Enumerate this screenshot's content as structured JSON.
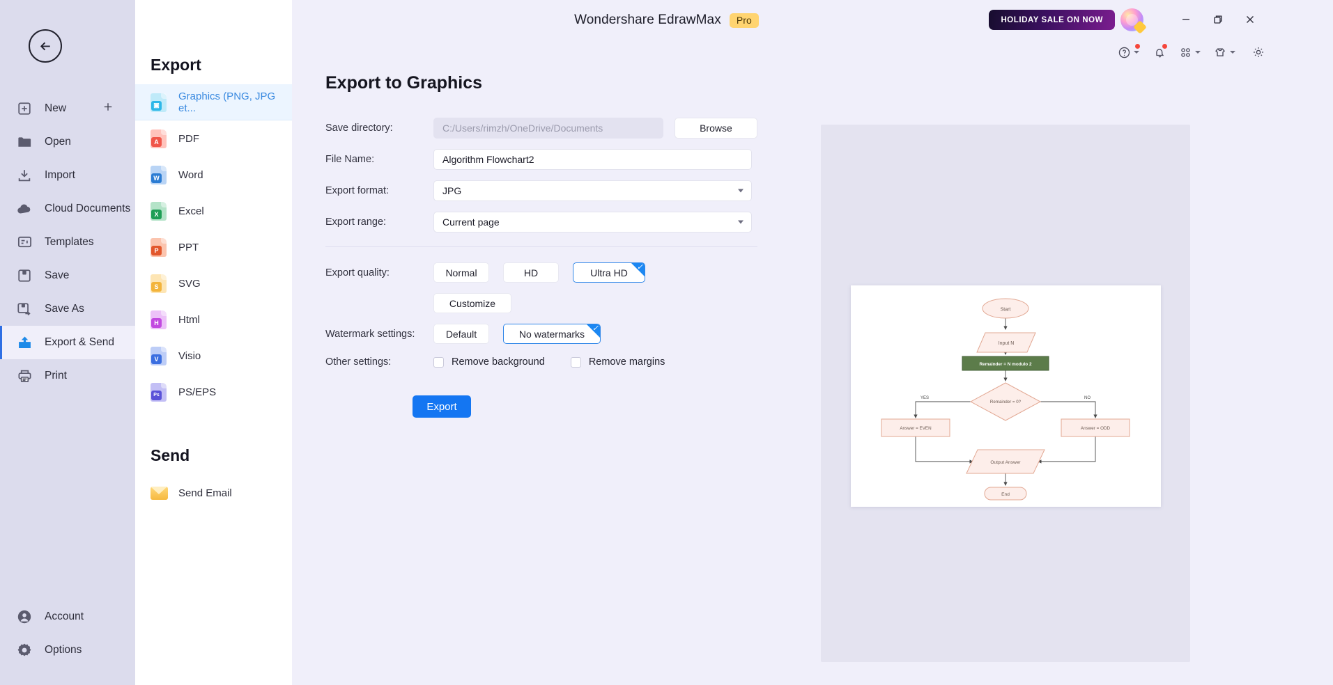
{
  "window": {
    "app_title": "Wondershare EdrawMax",
    "pro_badge": "Pro",
    "holiday_button": "HOLIDAY SALE ON NOW",
    "minimize_icon": "minimize-icon",
    "maximize_icon": "restore-icon",
    "close_icon": "close-icon",
    "avatar_icon": "user-avatar"
  },
  "toolbar": {
    "help_icon": "help-circle-icon",
    "notification_icon": "bell-icon",
    "apps_icon": "grid-apps-icon",
    "theme_icon": "shirt-theme-icon",
    "settings_icon": "gear-icon"
  },
  "rail": {
    "back_icon": "back-arrow-icon",
    "items": [
      {
        "label": "New",
        "icon": "new-document-icon",
        "active": false,
        "trailing": "plus-icon"
      },
      {
        "label": "Open",
        "icon": "folder-icon",
        "active": false
      },
      {
        "label": "Import",
        "icon": "import-icon",
        "active": false
      },
      {
        "label": "Cloud Documents",
        "icon": "cloud-icon",
        "active": false
      },
      {
        "label": "Templates",
        "icon": "templates-icon",
        "active": false
      },
      {
        "label": "Save",
        "icon": "save-disk-icon",
        "active": false
      },
      {
        "label": "Save As",
        "icon": "save-as-icon",
        "active": false
      },
      {
        "label": "Export & Send",
        "icon": "export-send-icon",
        "active": true
      },
      {
        "label": "Print",
        "icon": "printer-icon",
        "active": false
      }
    ],
    "bottom_items": [
      {
        "label": "Account",
        "icon": "account-icon"
      },
      {
        "label": "Options",
        "icon": "options-gear-icon"
      }
    ]
  },
  "export_panel": {
    "heading": "Export",
    "formats": [
      {
        "label": "Graphics (PNG, JPG et...",
        "icon": "image-file-icon",
        "color": "#45c4f0",
        "tag": "",
        "active": true
      },
      {
        "label": "PDF",
        "icon": "pdf-file-icon",
        "color": "#f0564a",
        "tag": "A",
        "active": false
      },
      {
        "label": "Word",
        "icon": "word-file-icon",
        "color": "#2b7cd3",
        "tag": "W",
        "active": false
      },
      {
        "label": "Excel",
        "icon": "excel-file-icon",
        "color": "#1e9e55",
        "tag": "X",
        "active": false
      },
      {
        "label": "PPT",
        "icon": "ppt-file-icon",
        "color": "#e2572c",
        "tag": "P",
        "active": false
      },
      {
        "label": "SVG",
        "icon": "svg-file-icon",
        "color": "#f3b43b",
        "tag": "S",
        "active": false
      },
      {
        "label": "Html",
        "icon": "html-file-icon",
        "color": "#c24ae0",
        "tag": "H",
        "active": false
      },
      {
        "label": "Visio",
        "icon": "visio-file-icon",
        "color": "#3b6ee0",
        "tag": "V",
        "active": false
      },
      {
        "label": "PS/EPS",
        "icon": "ps-file-icon",
        "color": "#5a52d8",
        "tag": "Ps",
        "active": false
      }
    ],
    "send_heading": "Send",
    "send_items": [
      {
        "label": "Send Email",
        "icon": "email-icon"
      }
    ]
  },
  "main": {
    "title": "Export to Graphics",
    "fields": {
      "save_directory_label": "Save directory:",
      "save_directory_value": "C:/Users/rimzh/OneDrive/Documents",
      "browse_label": "Browse",
      "file_name_label": "File Name:",
      "file_name_value": "Algorithm Flowchart2",
      "export_format_label": "Export format:",
      "export_format_value": "JPG",
      "export_range_label": "Export range:",
      "export_range_value": "Current page"
    },
    "quality": {
      "label": "Export quality:",
      "options": [
        "Normal",
        "HD",
        "Ultra HD"
      ],
      "selected": "Ultra HD",
      "customize_label": "Customize"
    },
    "watermark": {
      "label": "Watermark settings:",
      "options": [
        "Default",
        "No watermarks"
      ],
      "selected": "No watermarks"
    },
    "other": {
      "label": "Other settings:",
      "remove_background_label": "Remove background",
      "remove_background_checked": false,
      "remove_margins_label": "Remove margins",
      "remove_margins_checked": false
    },
    "export_button_label": "Export"
  },
  "preview": {
    "flowchart": {
      "nodes": [
        {
          "id": "start",
          "type": "terminator",
          "text": "Start"
        },
        {
          "id": "input",
          "type": "io",
          "text": "Input N"
        },
        {
          "id": "rem",
          "type": "process",
          "text": "Remainder = N modulo 2"
        },
        {
          "id": "dec",
          "type": "decision",
          "text": "Remainder = 0?"
        },
        {
          "id": "even",
          "type": "process",
          "text": "Answer = EVEN"
        },
        {
          "id": "odd",
          "type": "process",
          "text": "Answer = ODD"
        },
        {
          "id": "out",
          "type": "io",
          "text": "Output Answer"
        },
        {
          "id": "end",
          "type": "terminator",
          "text": "End"
        }
      ],
      "edges": [
        {
          "from": "start",
          "to": "input",
          "label": ""
        },
        {
          "from": "input",
          "to": "rem",
          "label": ""
        },
        {
          "from": "rem",
          "to": "dec",
          "label": ""
        },
        {
          "from": "dec",
          "to": "even",
          "label": "YES"
        },
        {
          "from": "dec",
          "to": "odd",
          "label": "NO"
        },
        {
          "from": "even",
          "to": "out",
          "label": ""
        },
        {
          "from": "odd",
          "to": "out",
          "label": ""
        },
        {
          "from": "out",
          "to": "end",
          "label": ""
        }
      ]
    }
  },
  "colors": {
    "accent": "#1476f2",
    "app_background": "#f0effa",
    "rail_background": "#dcdced",
    "panel_background": "#ffffff",
    "selected_item": "#ecf5ff",
    "preview_background": "#e4e3f0"
  }
}
